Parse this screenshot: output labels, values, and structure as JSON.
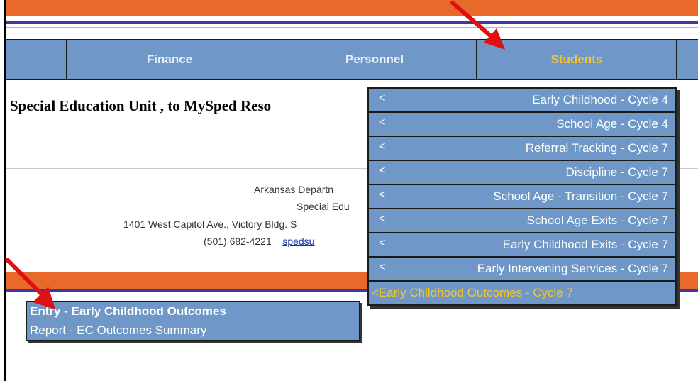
{
  "nav": {
    "items": [
      {
        "label": ""
      },
      {
        "label": "Finance"
      },
      {
        "label": "Personnel"
      },
      {
        "label": "Students"
      },
      {
        "label": ""
      }
    ]
  },
  "page": {
    "heading": "Special Education Unit , to MySped Reso"
  },
  "footer": {
    "line1": "Arkansas Departn",
    "line2": "Special Edu",
    "line3": "1401 West Capitol Ave., Victory Bldg. S",
    "phone": "(501) 682-4221",
    "link": "spedsu"
  },
  "dropdown": {
    "items": [
      {
        "arrow": "<",
        "label": "Early Childhood - Cycle 4"
      },
      {
        "arrow": "<",
        "label": "School Age - Cycle 4"
      },
      {
        "arrow": "<",
        "label": "Referral Tracking - Cycle 7"
      },
      {
        "arrow": "<",
        "label": "Discipline - Cycle 7"
      },
      {
        "arrow": "<",
        "label": "School Age - Transition - Cycle 7"
      },
      {
        "arrow": "<",
        "label": "School Age Exits - Cycle 7"
      },
      {
        "arrow": "<",
        "label": "Early Childhood Exits - Cycle 7"
      },
      {
        "arrow": "<",
        "label": "Early Intervening Services - Cycle 7"
      },
      {
        "arrow": "",
        "label": "<Early Childhood Outcomes - Cycle 7"
      }
    ]
  },
  "submenu": {
    "items": [
      {
        "label": "Entry - Early Childhood Outcomes"
      },
      {
        "label": "Report - EC Outcomes Summary"
      }
    ]
  },
  "colors": {
    "orange": "#e8692a",
    "purple": "#3a3aa0",
    "menu_blue": "#6f98c8",
    "active_yellow": "#f7c52a",
    "arrow_red": "#e01010"
  }
}
